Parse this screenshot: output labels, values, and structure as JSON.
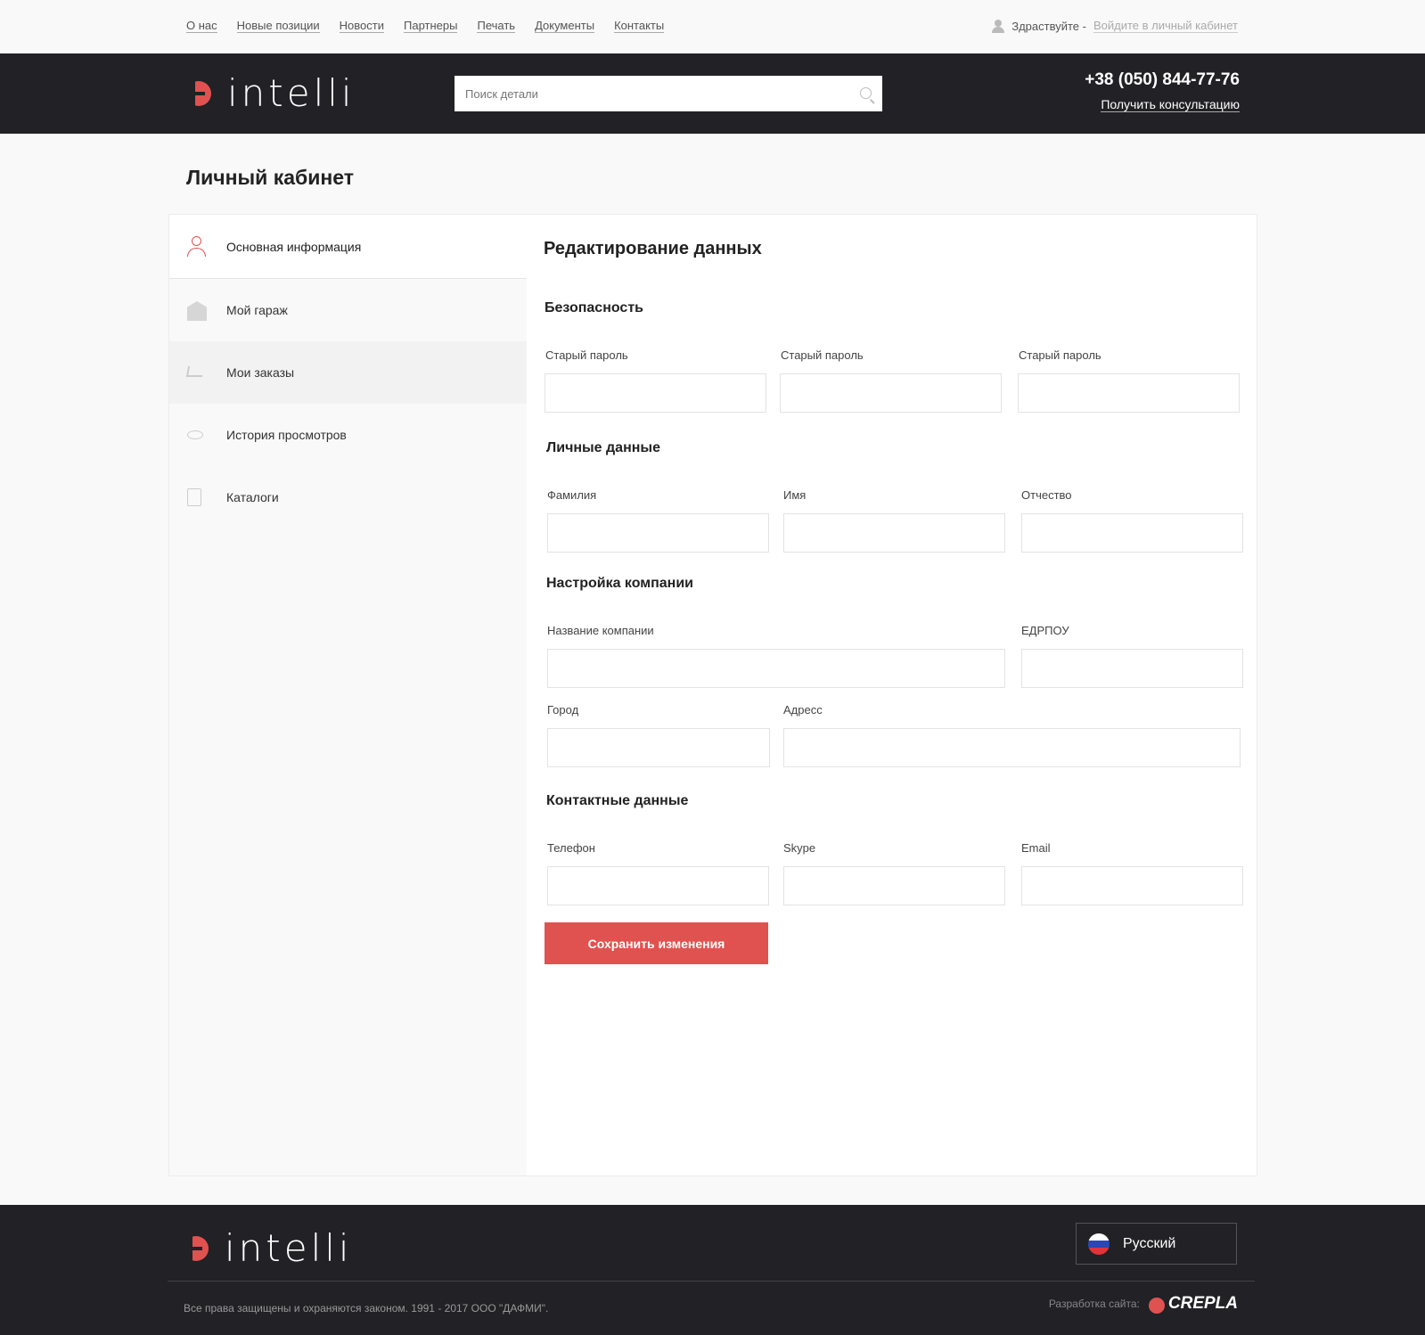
{
  "topnav": {
    "links": [
      "О нас",
      "Новые позиции",
      "Новости",
      "Партнеры",
      "Печать",
      "Документы",
      "Контакты"
    ],
    "greeting": "Здраствуйте -",
    "login_link": "Войдите в личный кабинет"
  },
  "header": {
    "logo_text": "intelli",
    "search_placeholder": "Поиск детали",
    "phone": "+38 (050) 844-77-76",
    "consult_link": "Получить консультацию"
  },
  "page": {
    "title": "Личный кабинет"
  },
  "sidebar": {
    "items": [
      {
        "label": "Основная информация",
        "icon": "user-icon",
        "active": true
      },
      {
        "label": "Мой гараж",
        "icon": "garage-icon"
      },
      {
        "label": "Мои заказы",
        "icon": "cart-icon"
      },
      {
        "label": "История просмотров",
        "icon": "eye-icon"
      },
      {
        "label": "Каталоги",
        "icon": "pdf-icon"
      }
    ]
  },
  "form": {
    "title": "Редактирование данных",
    "security": {
      "title": "Безопасность",
      "fields": [
        {
          "label": "Старый пароль",
          "value": ""
        },
        {
          "label": "Старый пароль",
          "value": ""
        },
        {
          "label": "Старый пароль",
          "value": ""
        }
      ]
    },
    "personal": {
      "title": "Личные данные",
      "fields": [
        {
          "label": "Фамилия",
          "value": ""
        },
        {
          "label": "Имя",
          "value": ""
        },
        {
          "label": "Отчество",
          "value": ""
        }
      ]
    },
    "company": {
      "title": "Настройка компании",
      "fields": [
        {
          "label": "Название компании",
          "value": ""
        },
        {
          "label": "ЕДРПОУ",
          "value": ""
        },
        {
          "label": "Город",
          "value": ""
        },
        {
          "label": "Адресс",
          "value": ""
        }
      ]
    },
    "contacts": {
      "title": "Контактные данные",
      "fields": [
        {
          "label": "Телефон",
          "value": ""
        },
        {
          "label": "Skype",
          "value": ""
        },
        {
          "label": "Email",
          "value": ""
        }
      ]
    },
    "save_label": "Сохранить изменения"
  },
  "footer": {
    "logo_text": "intelli",
    "language": "Русский",
    "copyright": "Все права защищены и охраняются законом. 1991 - 2017 ООО \"ДАФМИ\".",
    "dev_label": "Разработка сайта:",
    "dev_logo": "CREPLA"
  },
  "colors": {
    "accent": "#e0524f",
    "dark": "#212126",
    "bg": "#f9f9f9"
  }
}
